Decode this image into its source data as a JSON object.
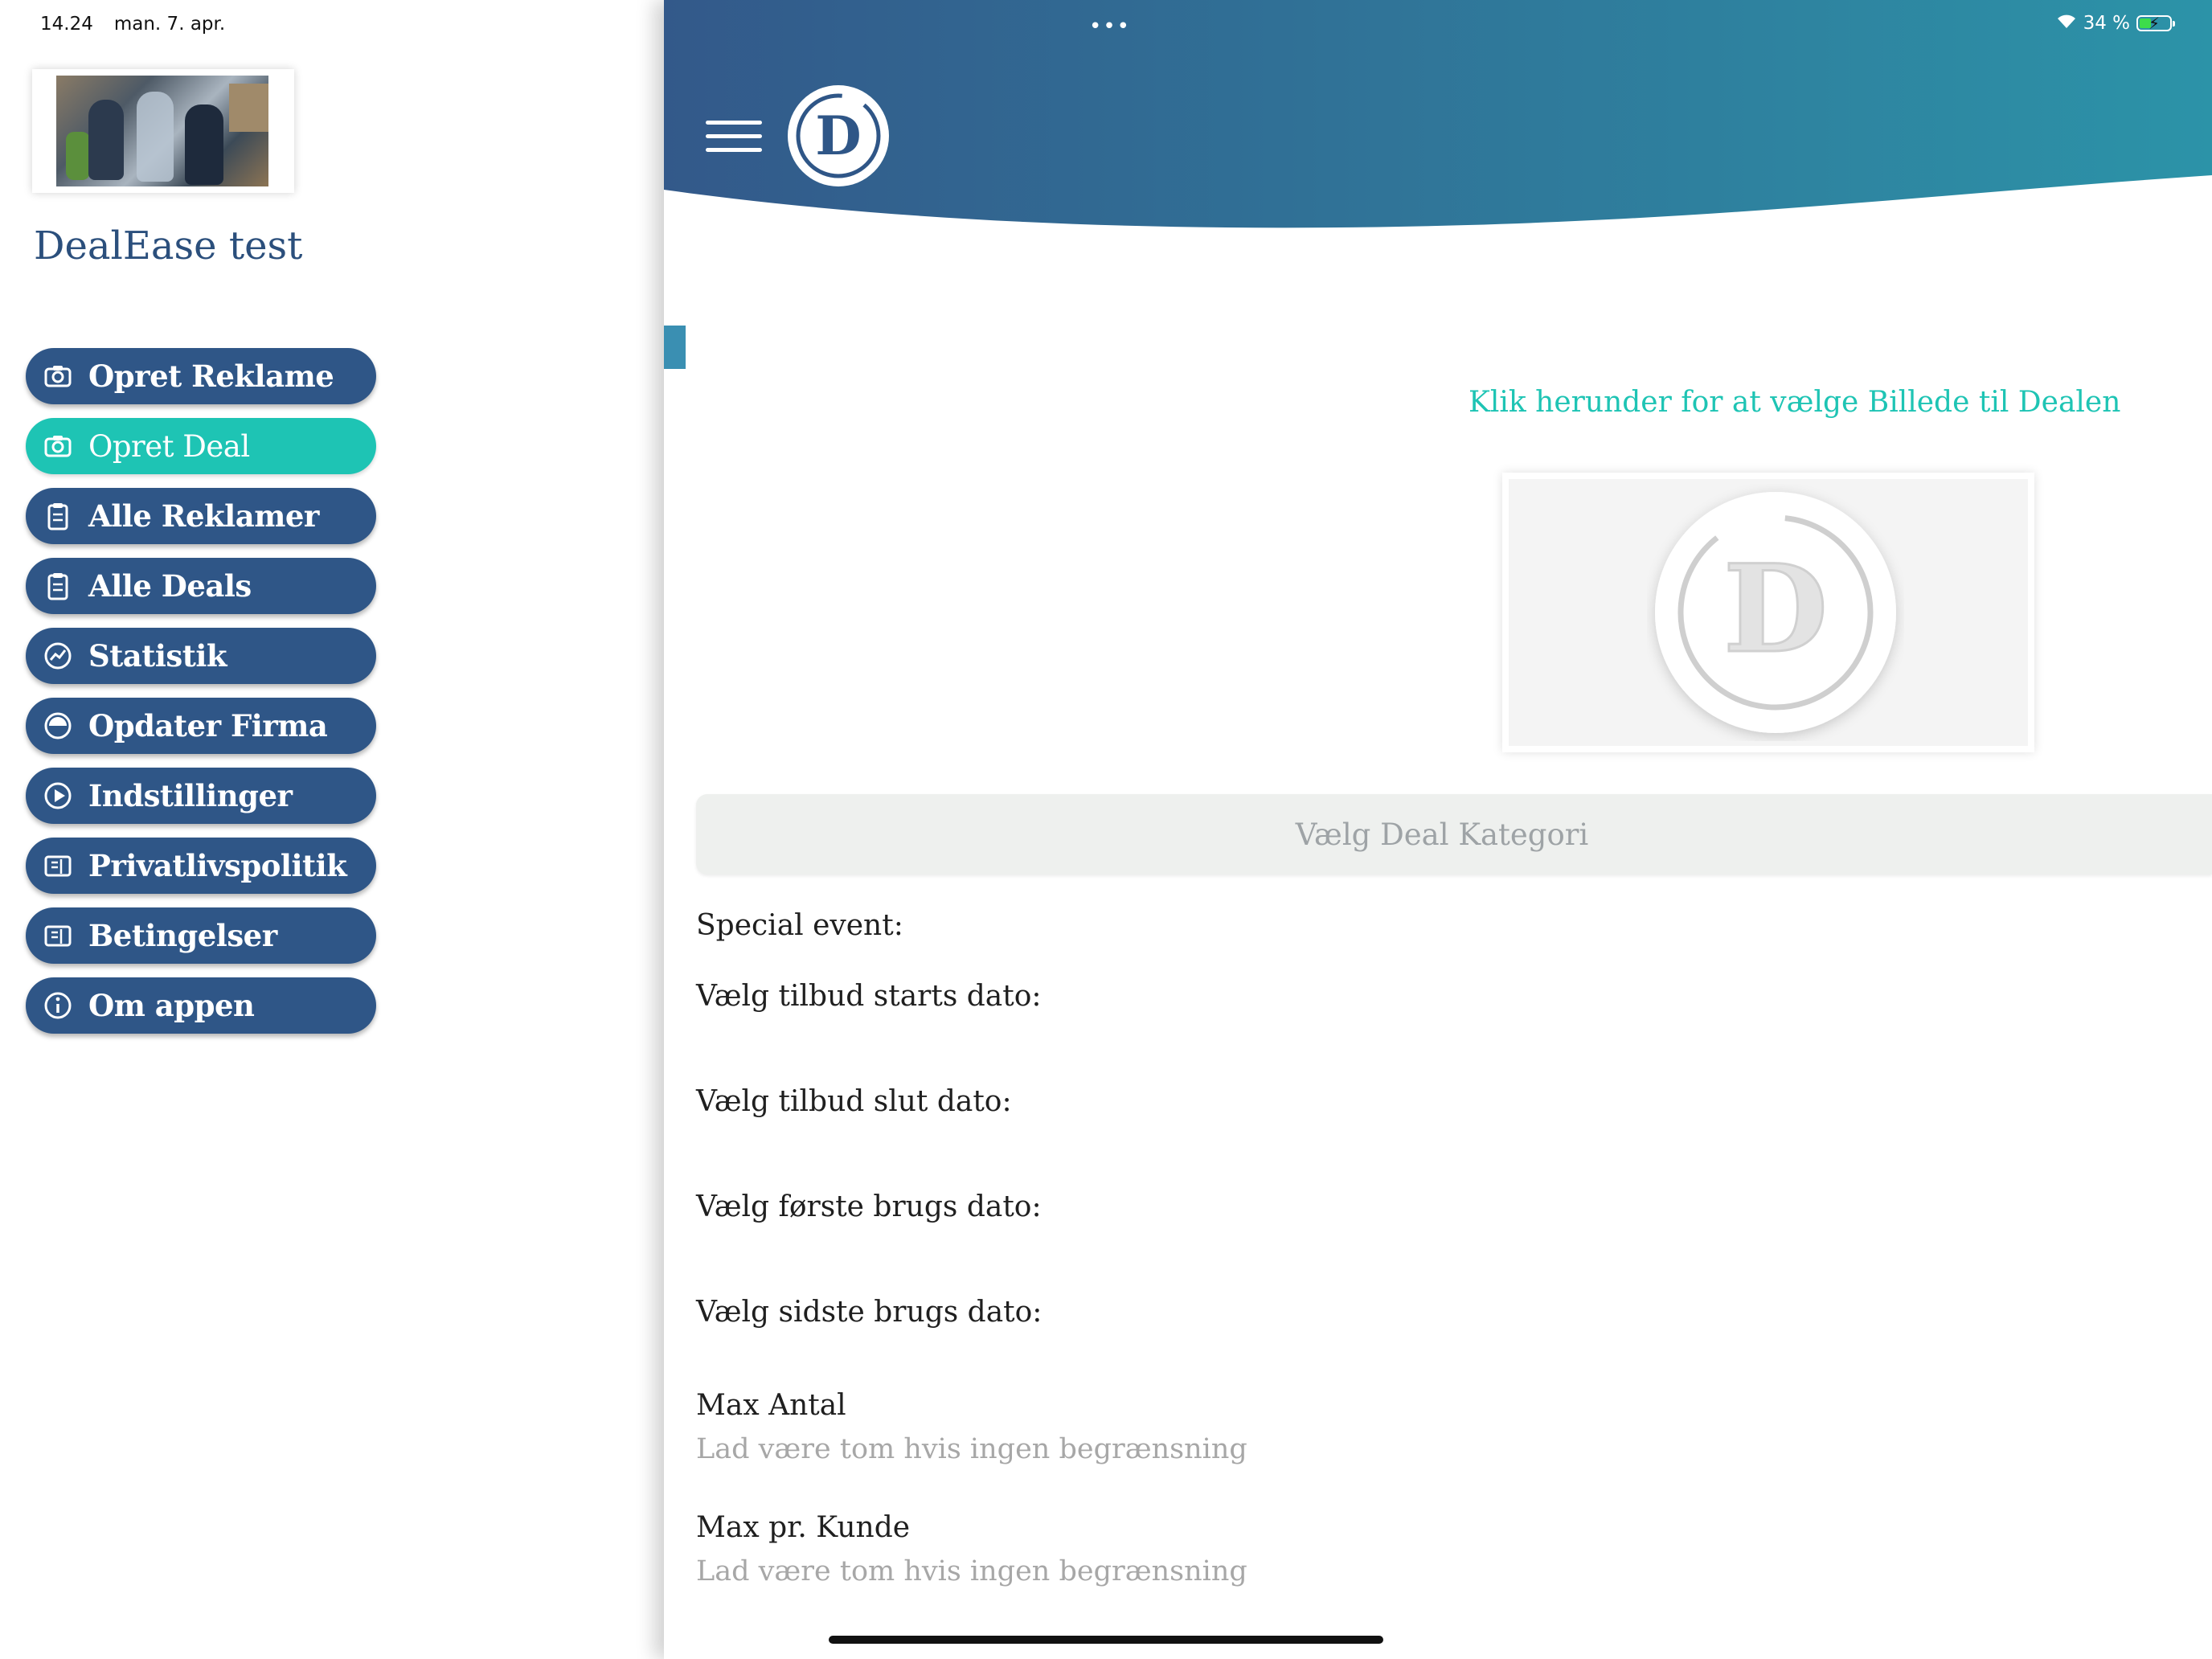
{
  "status_bar": {
    "time": "14.24",
    "date": "man. 7. apr.",
    "battery": "34 %",
    "battery_level": 0.34,
    "notch_dots": "•••",
    "wifi_icon": "wifi-icon",
    "battery_icon": "battery-charging-icon"
  },
  "sidebar": {
    "company_name": "DealEase test",
    "items": [
      {
        "label": "Opret Reklame",
        "icon": "camera-icon"
      },
      {
        "label": "Opret Deal",
        "icon": "camera-icon",
        "active": true
      },
      {
        "label": "Alle Reklamer",
        "icon": "clipboard-icon"
      },
      {
        "label": "Alle Deals",
        "icon": "clipboard-icon"
      },
      {
        "label": "Statistik",
        "icon": "chart-icon"
      },
      {
        "label": "Opdater Firma",
        "icon": "building-icon"
      },
      {
        "label": "Indstillinger",
        "icon": "settings-icon"
      },
      {
        "label": "Privatlivspolitik",
        "icon": "document-icon"
      },
      {
        "label": "Betingelser",
        "icon": "document-icon"
      },
      {
        "label": "Om appen",
        "icon": "info-icon"
      }
    ]
  },
  "header": {
    "logo_letter": "D",
    "menu_icon": "hamburger-menu-icon"
  },
  "form": {
    "image_prompt": "Klik herunder for at vælge Billede til Dealen",
    "placeholder_letter": "D",
    "category_placeholder": "Vælg Deal Kategori",
    "special_event_label": "Special event:",
    "start_date_label": "Vælg tilbud starts dato:",
    "end_date_label": "Vælg tilbud slut dato:",
    "first_use_label": "Vælg første brugs dato:",
    "last_use_label": "Vælg sidste brugs dato:",
    "max_count_label": "Max Antal",
    "max_count_placeholder": "Lad være tom hvis ingen begrænsning",
    "max_per_customer_label": "Max pr. Kunde",
    "max_per_customer_placeholder": "Lad være tom hvis ingen begrænsning"
  },
  "colors": {
    "header_start": "#33598a",
    "header_end": "#2c93a8",
    "menu_bg": "#2f5687",
    "accent": "#1ec4b4"
  }
}
